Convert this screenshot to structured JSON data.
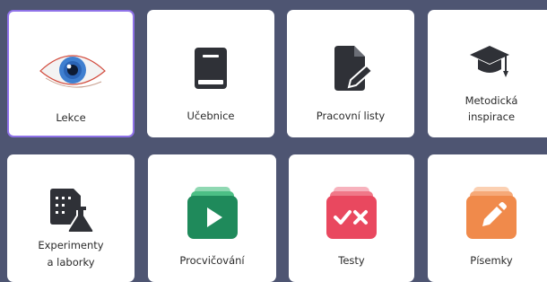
{
  "tiles": [
    {
      "name": "lekce",
      "label": "Lekce",
      "icon": "eye-icon",
      "selected": true
    },
    {
      "name": "ucebnice",
      "label": "Učebnice",
      "icon": "book-icon"
    },
    {
      "name": "pracovni-listy",
      "label": "Pracovní listy",
      "icon": "document-edit-icon"
    },
    {
      "name": "metodicka-inspirace",
      "label_line1": "Metodická",
      "label_line2": "inspirace",
      "icon": "graduation-cap-icon"
    },
    {
      "name": "experimenty",
      "label_line1": "Experimenty",
      "label_line2": "a laborky",
      "icon": "lab-flask-icon"
    },
    {
      "name": "procvicovani",
      "label": "Procvičování",
      "icon": "play-cards-icon",
      "color": "#1f8a5b"
    },
    {
      "name": "testy",
      "label": "Testy",
      "icon": "check-cross-cards-icon",
      "color": "#e9485f"
    },
    {
      "name": "pisemky",
      "label": "Písemky",
      "icon": "pencil-cards-icon",
      "color": "#f08a4b"
    }
  ]
}
